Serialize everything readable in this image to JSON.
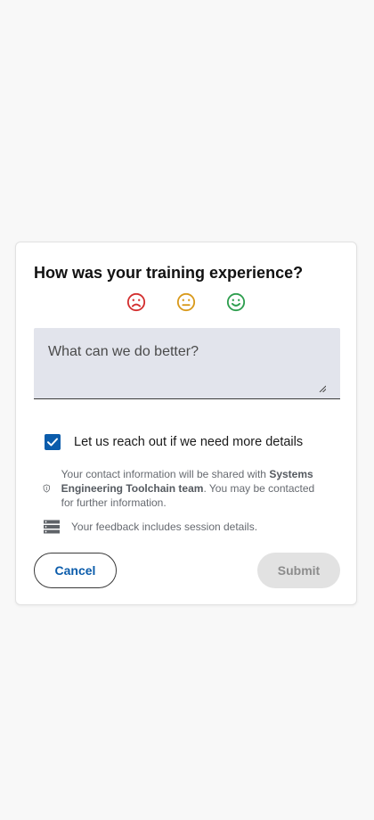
{
  "dialog": {
    "title": "How was your training experience?",
    "ratings": [
      {
        "name": "dissatisfied",
        "icon": "sad-face-icon",
        "color": "#d32f2f"
      },
      {
        "name": "neutral",
        "icon": "neutral-face-icon",
        "color": "#d99a1c"
      },
      {
        "name": "satisfied",
        "icon": "happy-face-icon",
        "color": "#2e9e4e"
      }
    ],
    "feedback": {
      "placeholder": "What can we do better?",
      "value": ""
    },
    "contact_opt_in": {
      "label": "Let us reach out if we need more details",
      "checked": true,
      "color": "#0b5cab"
    },
    "contact_info": {
      "icon": "shield-info-icon",
      "text_before": "Your contact information will be shared with ",
      "team": "Systems Engineering Toolchain team",
      "text_after": ". You may be contacted for further information."
    },
    "session_info": {
      "icon": "server-icon",
      "text": "Your feedback includes session details."
    },
    "buttons": {
      "cancel": "Cancel",
      "submit": "Submit"
    }
  }
}
